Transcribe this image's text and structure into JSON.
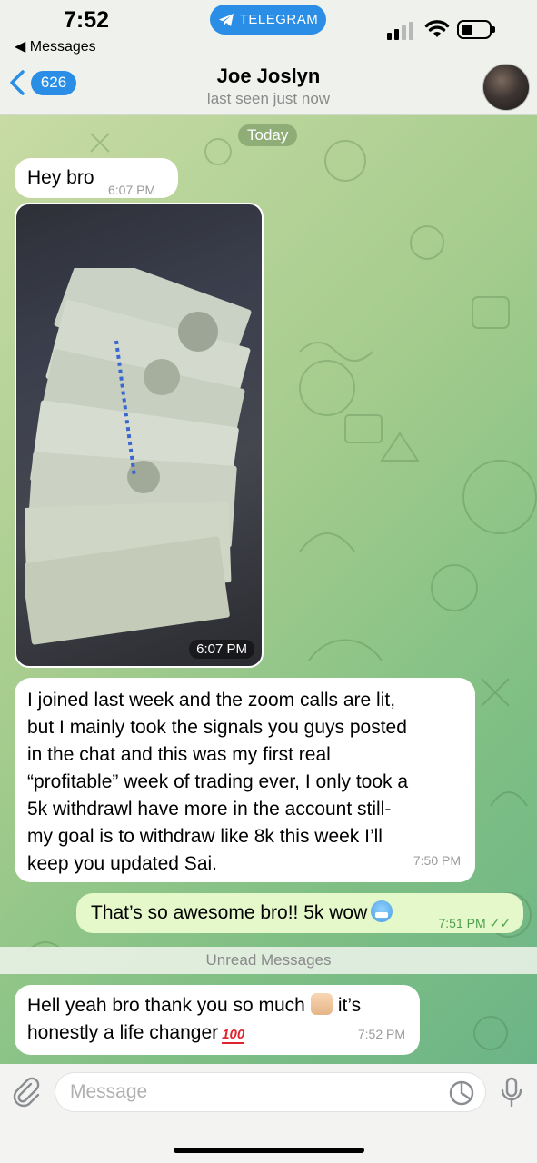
{
  "status_bar": {
    "time": "7:52",
    "back_app": "◀ Messages",
    "pill_label": "TELEGRAM",
    "signal_bars_active": 2,
    "signal_bars_total": 4
  },
  "header": {
    "back_count": "626",
    "contact_name": "Joe Joslyn",
    "contact_status": "last seen just now"
  },
  "chat": {
    "date_label": "Today",
    "messages": [
      {
        "text": "Hey bro",
        "time": "6:07 PM",
        "direction": "incoming"
      },
      {
        "type": "photo",
        "time": "6:07 PM",
        "direction": "incoming"
      },
      {
        "text": "I joined last week and the zoom calls are lit,\nbut I mainly took the signals you guys posted\nin the chat and this was my first real\n“profitable” week of trading ever, I only took a\n5k withdrawl have more in the account still-\nmy goal is to withdraw like 8k this week I’ll\nkeep you updated Sai.",
        "time": "7:50 PM",
        "direction": "incoming"
      },
      {
        "text": "That’s so awesome bro!! 5k wow",
        "time": "7:51 PM",
        "read_mark": "✓✓",
        "direction": "outgoing"
      },
      {
        "text_line1": "Hell yeah bro thank you so much",
        "text_line1b": "it’s",
        "text_line2": "honestly a life changer",
        "time": "7:52 PM",
        "direction": "incoming"
      }
    ],
    "unread_divider": "Unread Messages"
  },
  "composer": {
    "placeholder": "Message"
  },
  "colors": {
    "accent": "#2a8ee6",
    "outgoing_bubble": "#e4f8c9",
    "read_check": "#4fa14f"
  }
}
